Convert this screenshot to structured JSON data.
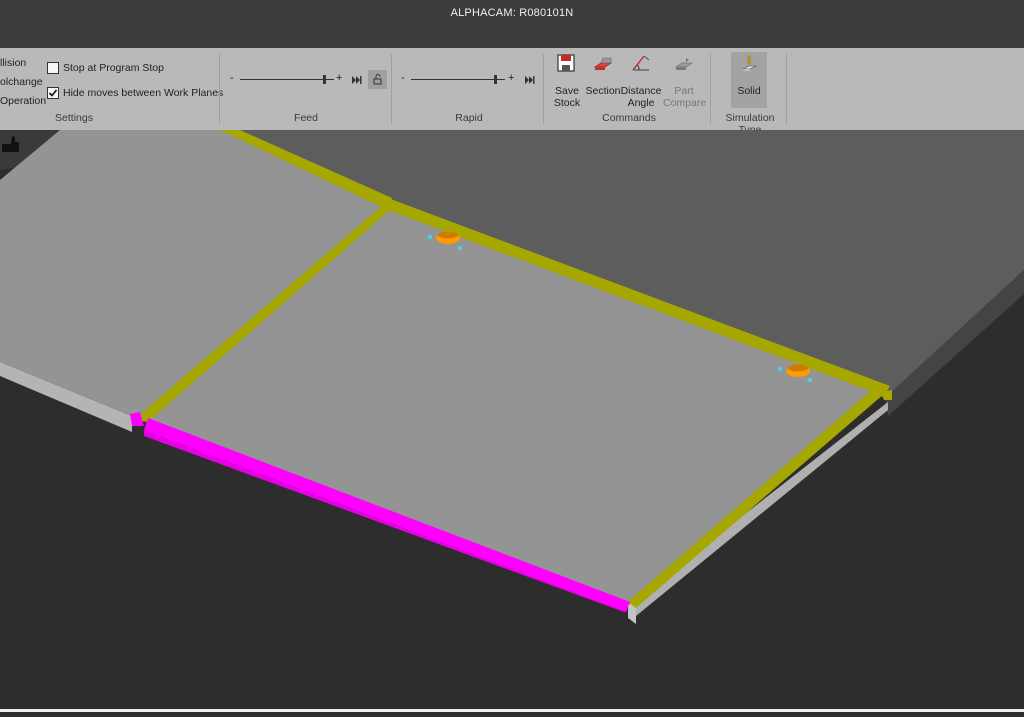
{
  "app": {
    "title": "ALPHACAM: R080101N"
  },
  "settings": {
    "left_items": [
      "llision",
      "olchange",
      "Operation"
    ],
    "stop_at_program_stop": {
      "label": "Stop at Program Stop",
      "checked": false
    },
    "hide_moves": {
      "label": "Hide moves between Work Planes",
      "checked": true
    },
    "group_label": "Settings"
  },
  "feed": {
    "minus": "-",
    "plus": "+",
    "group_label": "Feed",
    "level": 0.9
  },
  "rapid": {
    "minus": "-",
    "plus": "+",
    "group_label": "Rapid",
    "level": 0.9
  },
  "commands": {
    "group_label": "Commands",
    "save_stock": {
      "line1": "Save",
      "line2": "Stock"
    },
    "section": {
      "line1": "Section"
    },
    "distance_angle": {
      "line1": "Distance",
      "line2": "Angle"
    },
    "part_compare": {
      "line1": "Part",
      "line2": "Compare"
    }
  },
  "simulation": {
    "group_label": "Simulation Type",
    "solid_label": "Solid"
  },
  "icons": [
    "save-stock-icon",
    "section-icon",
    "distance-angle-icon",
    "part-compare-icon",
    "solid-icon",
    "lock-icon",
    "skip-end-icon",
    "thumb-icon"
  ],
  "colors": {
    "panel_top": "#949494",
    "edge_yellow": "#a6a800",
    "edge_magenta": "#ff00ff",
    "hole_orange": "#ff9a00",
    "ribbon_bg": "#b9b9b9",
    "titlebar_bg": "#3c3c3c",
    "viewport_bg": "#2d2d2d"
  }
}
